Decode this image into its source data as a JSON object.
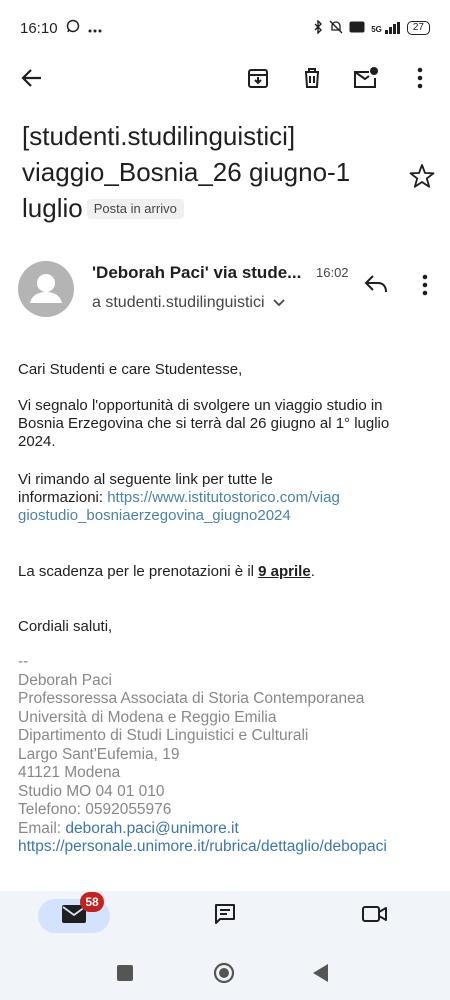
{
  "status_bar": {
    "time": "16:10",
    "battery": "27",
    "network": "5G",
    "icons": [
      "whatsapp-icon",
      "more-dots-icon",
      "bluetooth-icon",
      "mute-icon",
      "volte-icon",
      "signal-icon",
      "battery-icon"
    ]
  },
  "app_bar": {
    "icons": [
      "back-arrow-icon",
      "archive-icon",
      "delete-icon",
      "mark-unread-icon",
      "more-vert-icon"
    ]
  },
  "email": {
    "subject_line1": "[studenti.studilinguistici]",
    "subject_line2": "viaggio_Bosnia_26 giugno-1",
    "subject_line3": "luglio",
    "label_chip": "Posta in arrivo",
    "sender": "'Deborah Paci' via stude...",
    "time": "16:02",
    "recipient": "a studenti.studilinguistici",
    "greeting": "Cari Studenti e care Studentesse,",
    "para1": "Vi segnalo l'opportunità di svolgere un viaggio studio in Bosnia Erzegovina che si terrà  dal 26 giugno al 1° luglio 2024.",
    "para2_text": "Vi rimando al seguente link per tutte le informazioni: ",
    "para2_link": "https://www.istitutostorico.com/viaggiostudio_bosniaerzegovina_giugno2024",
    "deadline_text": "La scadenza per le prenotazioni è il ",
    "deadline_date": "9 aprile",
    "deadline_end": ".",
    "closing": "Cordiali saluti,",
    "sig_sep": "--",
    "sig_name": "Deborah Paci",
    "sig_title": "Professoressa Associata di Storia Contemporanea",
    "sig_university": "Università di Modena e Reggio Emilia",
    "sig_department": "Dipartimento di Studi Linguistici e Culturali",
    "sig_street": "Largo Sant'Eufemia, 19",
    "sig_city": "41121 Modena",
    "sig_office": "Studio MO 04 01 010",
    "sig_phone": "Telefono: 0592055976",
    "sig_email_label": "Email: ",
    "sig_email": "deborah.paci@unimore.it",
    "sig_url": "https://personale.unimore.it/rubrica/dettaglio/debopaci"
  },
  "bottom_nav": {
    "mail_badge": "58",
    "items": [
      "mail-icon",
      "chat-icon",
      "meet-icon"
    ]
  },
  "colors": {
    "link": "#4a83a8",
    "badge": "#c5221f",
    "nav_active": "#d3e3fd",
    "nav_bg": "#f1f4f9"
  }
}
